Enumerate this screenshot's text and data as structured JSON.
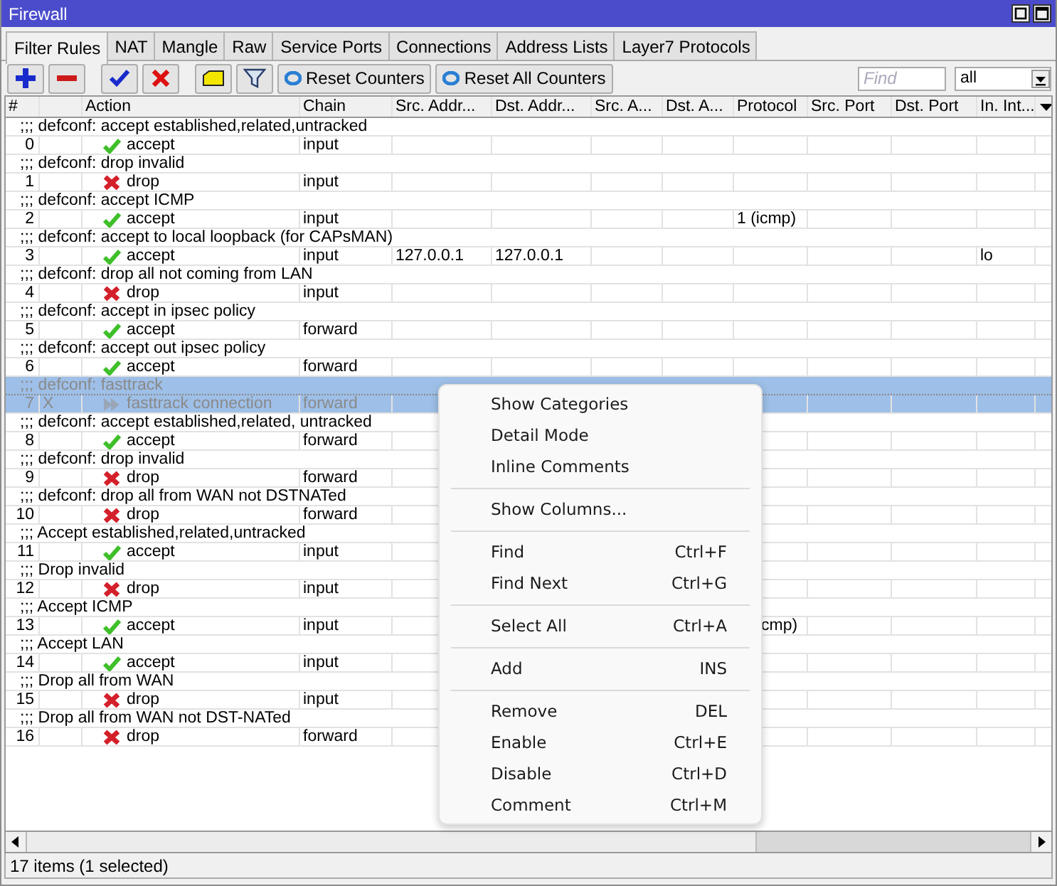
{
  "window": {
    "title": "Firewall"
  },
  "tabs": [
    {
      "label": "Filter Rules",
      "selected": true
    },
    {
      "label": "NAT",
      "selected": false
    },
    {
      "label": "Mangle",
      "selected": false
    },
    {
      "label": "Raw",
      "selected": false
    },
    {
      "label": "Service Ports",
      "selected": false
    },
    {
      "label": "Connections",
      "selected": false
    },
    {
      "label": "Address Lists",
      "selected": false
    },
    {
      "label": "Layer7 Protocols",
      "selected": false
    }
  ],
  "toolbar": {
    "buttons": [
      {
        "kind": "add"
      },
      {
        "kind": "remove"
      },
      {
        "kind": "enable"
      },
      {
        "kind": "disable"
      },
      {
        "kind": "comment"
      },
      {
        "kind": "filter"
      }
    ],
    "text_buttons": [
      "Reset Counters",
      "Reset All Counters"
    ],
    "find": {
      "placeholder": "Find"
    },
    "filter_select": "all"
  },
  "table": {
    "columns": [
      "#",
      "Action",
      "Chain",
      "Src. Addr...",
      "Dst. Addr...",
      "Src. A...",
      "Dst. A...",
      "Protocol",
      "Src. Port",
      "Dst. Port",
      "In. Int..."
    ],
    "rules": [
      {
        "comment": ";;; defconf: accept established,related,untracked",
        "number": "0",
        "action": "accept",
        "chain": "input",
        "disabled": false,
        "selected": false
      },
      {
        "comment": ";;; defconf: drop invalid",
        "number": "1",
        "action": "drop",
        "chain": "input",
        "disabled": false,
        "selected": false
      },
      {
        "comment": ";;; defconf: accept ICMP",
        "number": "2",
        "action": "accept",
        "chain": "input",
        "protocol": "1 (icmp)",
        "disabled": false,
        "selected": false
      },
      {
        "comment": ";;; defconf: accept to local loopback (for CAPsMAN)",
        "number": "3",
        "action": "accept",
        "chain": "input",
        "src": "127.0.0.1",
        "dst": "127.0.0.1",
        "in_interface": "lo",
        "disabled": false,
        "selected": false
      },
      {
        "comment": ";;; defconf: drop all not coming from LAN",
        "number": "4",
        "action": "drop",
        "chain": "input",
        "disabled": false,
        "selected": false
      },
      {
        "comment": ";;; defconf: accept in ipsec policy",
        "number": "5",
        "action": "accept",
        "chain": "forward",
        "disabled": false,
        "selected": false
      },
      {
        "comment": ";;; defconf: accept out ipsec policy",
        "number": "6",
        "action": "accept",
        "chain": "forward",
        "disabled": false,
        "selected": false
      },
      {
        "comment": ";;; defconf: fasttrack",
        "number": "7",
        "flags": "X",
        "action": "fasttrack connection",
        "chain": "forward",
        "disabled": true,
        "selected": true
      },
      {
        "comment": ";;; defconf: accept established,related, untracked",
        "number": "8",
        "action": "accept",
        "chain": "forward",
        "disabled": false,
        "selected": false
      },
      {
        "comment": ";;; defconf: drop invalid",
        "number": "9",
        "action": "drop",
        "chain": "forward",
        "disabled": false,
        "selected": false
      },
      {
        "comment": ";;; defconf: drop all from WAN not DSTNATed",
        "number": "10",
        "action": "drop",
        "chain": "forward",
        "disabled": false,
        "selected": false
      },
      {
        "comment": ";;; Accept established,related,untracked",
        "number": "11",
        "action": "accept",
        "chain": "input",
        "disabled": false,
        "selected": false
      },
      {
        "comment": ";;; Drop invalid",
        "number": "12",
        "action": "drop",
        "chain": "input",
        "disabled": false,
        "selected": false
      },
      {
        "comment": ";;; Accept ICMP",
        "number": "13",
        "action": "accept",
        "chain": "input",
        "protocol_partial": "cmp)",
        "disabled": false,
        "selected": false
      },
      {
        "comment": ";;; Accept LAN",
        "number": "14",
        "action": "accept",
        "chain": "input",
        "disabled": false,
        "selected": false
      },
      {
        "comment": ";;; Drop all from WAN",
        "number": "15",
        "action": "drop",
        "chain": "input",
        "disabled": false,
        "selected": false
      },
      {
        "comment": ";;; Drop all from WAN not DST-NATed",
        "number": "16",
        "action": "drop",
        "chain": "forward",
        "disabled": false,
        "selected": false
      }
    ]
  },
  "context_menu": {
    "groups": [
      [
        {
          "label": "Show Categories"
        },
        {
          "label": "Detail Mode"
        },
        {
          "label": "Inline Comments"
        }
      ],
      [
        {
          "label": "Show Columns..."
        }
      ],
      [
        {
          "label": "Find",
          "shortcut": "Ctrl+F"
        },
        {
          "label": "Find Next",
          "shortcut": "Ctrl+G"
        }
      ],
      [
        {
          "label": "Select All",
          "shortcut": "Ctrl+A"
        }
      ],
      [
        {
          "label": "Add",
          "shortcut": "INS"
        }
      ],
      [
        {
          "label": "Remove",
          "shortcut": "DEL"
        },
        {
          "label": "Enable",
          "shortcut": "Ctrl+E"
        },
        {
          "label": "Disable",
          "shortcut": "Ctrl+D"
        },
        {
          "label": "Comment",
          "shortcut": "Ctrl+M"
        }
      ]
    ]
  },
  "status_bar": "17 items (1 selected)"
}
